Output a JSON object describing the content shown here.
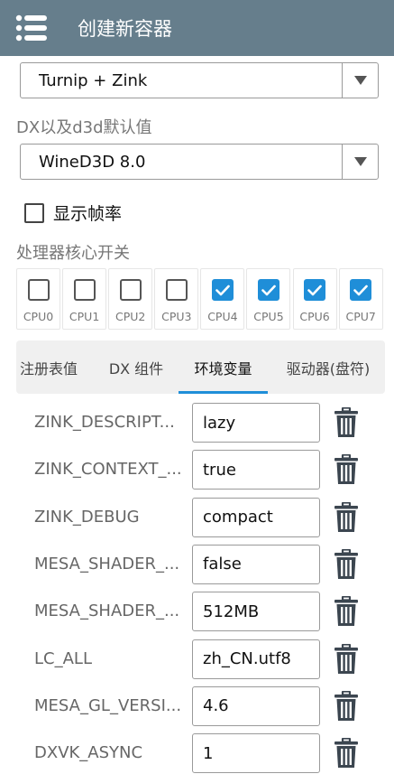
{
  "header": {
    "title": "创建新容器",
    "menu_icon": "menu-icon"
  },
  "graphics_driver": {
    "selected": "Turnip + Zink"
  },
  "dx_wrapper": {
    "label": "DX以及d3d默认值",
    "selected": "WineD3D 8.0"
  },
  "show_fps": {
    "label": "显示帧率",
    "checked": false
  },
  "cpu_affinity": {
    "label": "处理器核心开关",
    "cores": [
      {
        "label": "CPU0",
        "checked": false
      },
      {
        "label": "CPU1",
        "checked": false
      },
      {
        "label": "CPU2",
        "checked": false
      },
      {
        "label": "CPU3",
        "checked": false
      },
      {
        "label": "CPU4",
        "checked": true
      },
      {
        "label": "CPU5",
        "checked": true
      },
      {
        "label": "CPU6",
        "checked": true
      },
      {
        "label": "CPU7",
        "checked": true
      }
    ]
  },
  "tabs": [
    {
      "label": "注册表值",
      "active": false
    },
    {
      "label": "DX 组件",
      "active": false
    },
    {
      "label": "环境变量",
      "active": true
    },
    {
      "label": "驱动器(盘符)",
      "active": false
    }
  ],
  "env_vars": [
    {
      "name": "ZINK_DESCRIPT...",
      "value": "lazy"
    },
    {
      "name": "ZINK_CONTEXT_...",
      "value": "true"
    },
    {
      "name": "ZINK_DEBUG",
      "value": "compact"
    },
    {
      "name": "MESA_SHADER_...",
      "value": "false"
    },
    {
      "name": "MESA_SHADER_...",
      "value": "512MB"
    },
    {
      "name": "LC_ALL",
      "value": "zh_CN.utf8"
    },
    {
      "name": "MESA_GL_VERSI...",
      "value": "4.6"
    },
    {
      "name": "DXVK_ASYNC",
      "value": "1"
    }
  ],
  "colors": {
    "appbar": "#667e8c",
    "accent": "#1f8ed8",
    "icon": "#3c4650"
  }
}
